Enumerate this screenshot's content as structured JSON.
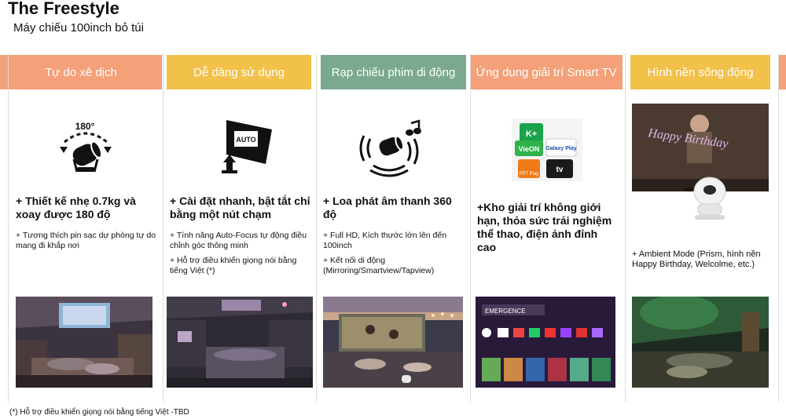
{
  "header": {
    "title": "The Freestyle",
    "subtitle": "Máy chiếu 100inch bỏ túi"
  },
  "columns": [
    {
      "heading": "Tự do xê dịch",
      "color": "#f4a079",
      "icon": "rotate-180-projector-icon",
      "icon_text": "180°",
      "main": "+ Thiết kế  nhẹ 0.7kg và xoay được 180 độ",
      "subs": [
        "+ Tương thích pin sạc dự phòng tự do mang đi khắp nơi"
      ]
    },
    {
      "heading": "Dễ dàng sử dụng",
      "color": "#f2c14a",
      "icon": "auto-focus-icon",
      "icon_text": "AUTO",
      "main": "+ Cài đặt nhanh, bật tắt chỉ bằng một nút chạm",
      "subs": [
        "+ Tính năng Auto-Focus tự động điều chỉnh góc thông minh",
        "+ Hỗ trợ điều khiển giọng nói bằng tiếng Việt (*)"
      ]
    },
    {
      "heading": "Rạp chiếu phim di động",
      "color": "#7aa990",
      "icon": "360-speaker-icon",
      "icon_text": "",
      "main": "+ Loa phát âm thanh 360 độ",
      "subs": [
        "+ Full HD, Kích thước lớn lên đến 100inch",
        "+ Kết nối di động (Mirroring/Smartview/Tapview)"
      ]
    },
    {
      "heading": "Ứng dụng giải trí Smart TV",
      "color": "#f4a079",
      "icon": "smart-tv-apps-icon",
      "icon_text": "",
      "apps": [
        "K+",
        "VieON",
        "Galaxy Play",
        "FPT Play",
        "tv"
      ],
      "main": "+Kho giải trí không giới hạn, thỏa sức trải nghiệm thể thao, điện ảnh đỉnh cao",
      "subs": []
    },
    {
      "heading": "Hình nền sống động",
      "color": "#f2c14a",
      "icon": "ambient-mode-photo",
      "icon_text": "Happy Birthday",
      "main": "",
      "subs": [
        "+ Ambient Mode (Prism,  hình nền Happy Birthday, Welcolme, etc.)"
      ]
    }
  ],
  "footnote": "(*) Hỗ trợ điều khiển giọng nói bằng tiếng Việt -TBD",
  "app_tile": {
    "tile_label": "EMERGENCE"
  }
}
